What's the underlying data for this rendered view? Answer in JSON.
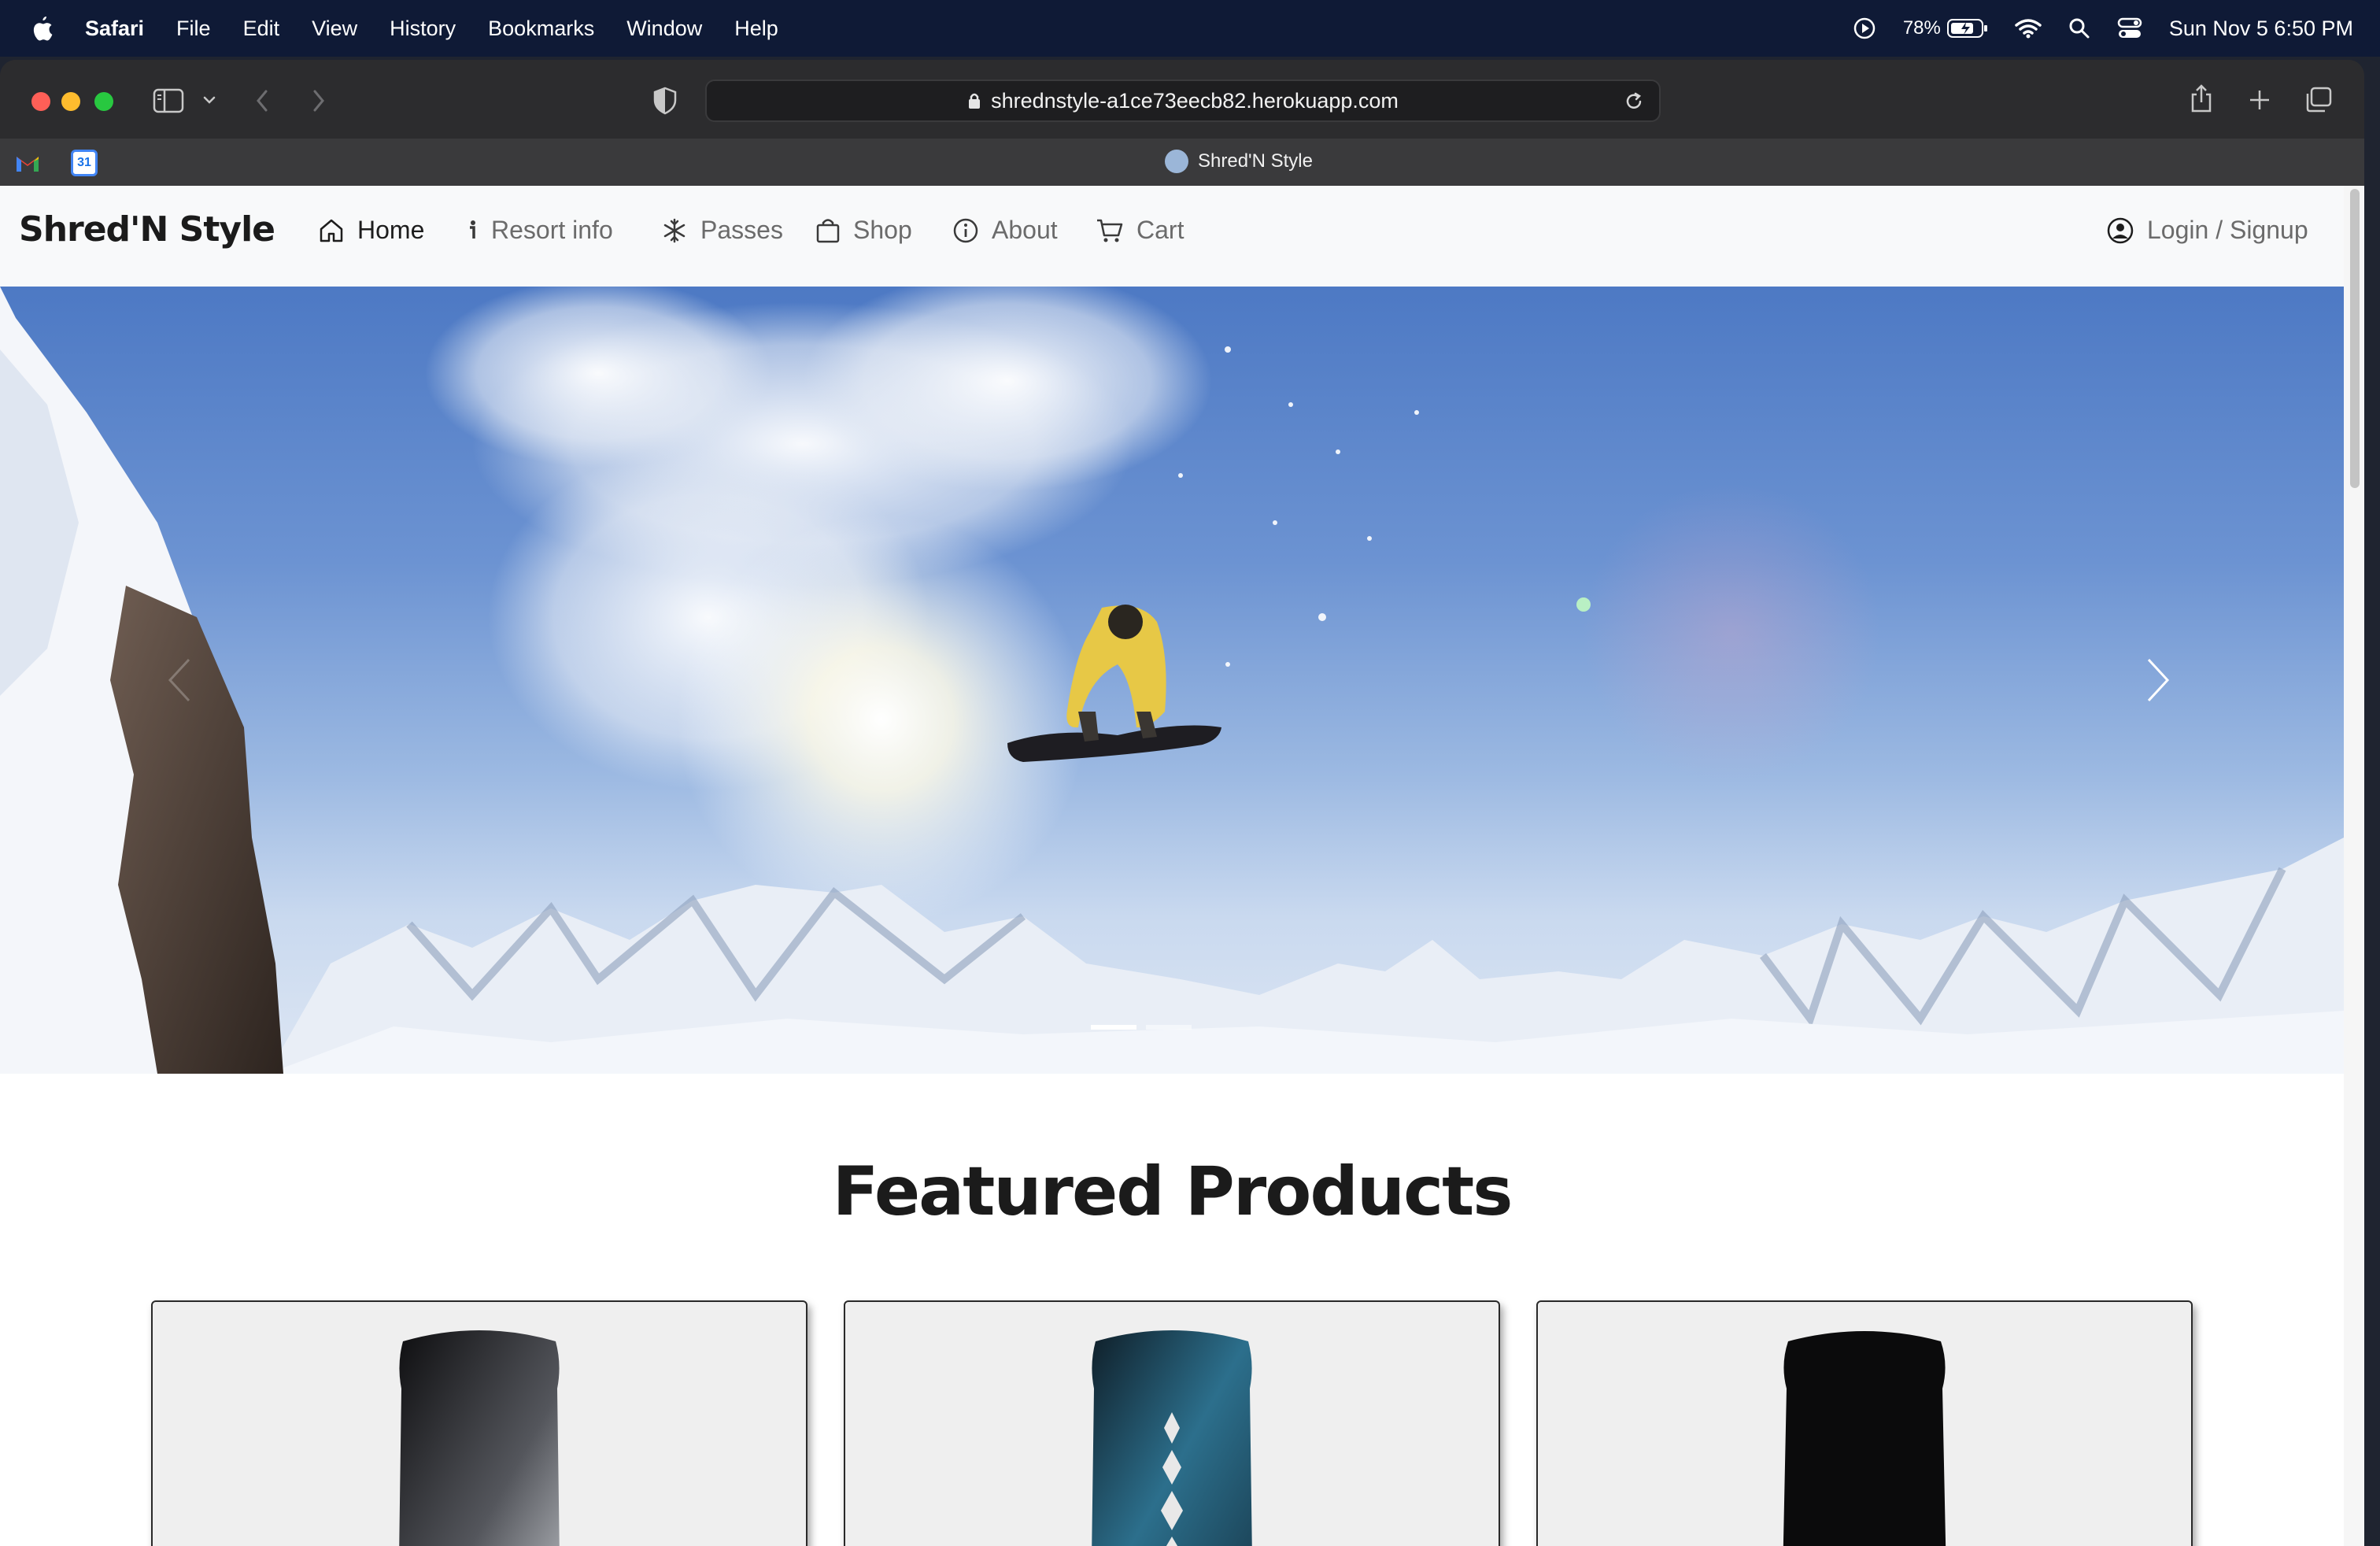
{
  "menubar": {
    "app_name": "Safari",
    "items": [
      "File",
      "Edit",
      "View",
      "History",
      "Bookmarks",
      "Window",
      "Help"
    ],
    "battery": "78%",
    "datetime": "Sun Nov 5  6:50 PM"
  },
  "browser": {
    "url": "shrednstyle-a1ce73eecb82.herokuapp.com",
    "tab_title": "Shred'N Style",
    "pinned_tabs": [
      "gmail",
      "calendar"
    ],
    "calendar_day": "31"
  },
  "site": {
    "brand": "Shred'N Style",
    "nav": [
      {
        "label": "Home",
        "icon": "house-icon",
        "active": true
      },
      {
        "label": "Resort info",
        "icon": "info-icon"
      },
      {
        "label": "Passes",
        "icon": "snowflake-icon"
      },
      {
        "label": "Shop",
        "icon": "bag-icon"
      },
      {
        "label": "About",
        "icon": "info-circle-icon"
      },
      {
        "label": "Cart",
        "icon": "cart-icon"
      }
    ],
    "login": "Login / Signup",
    "carousel": {
      "slides": 2,
      "active_index": 0
    },
    "featured_title": "Featured Products",
    "products": [
      {
        "board_color": "#2a2a2e"
      },
      {
        "board_color": "#1f4f63"
      },
      {
        "board_color": "#0f0f10"
      }
    ]
  },
  "colors": {
    "menubar_bg": "#0f1a36",
    "navbar_bg": "#f8f9fa",
    "sky_top": "#4d79c4"
  }
}
